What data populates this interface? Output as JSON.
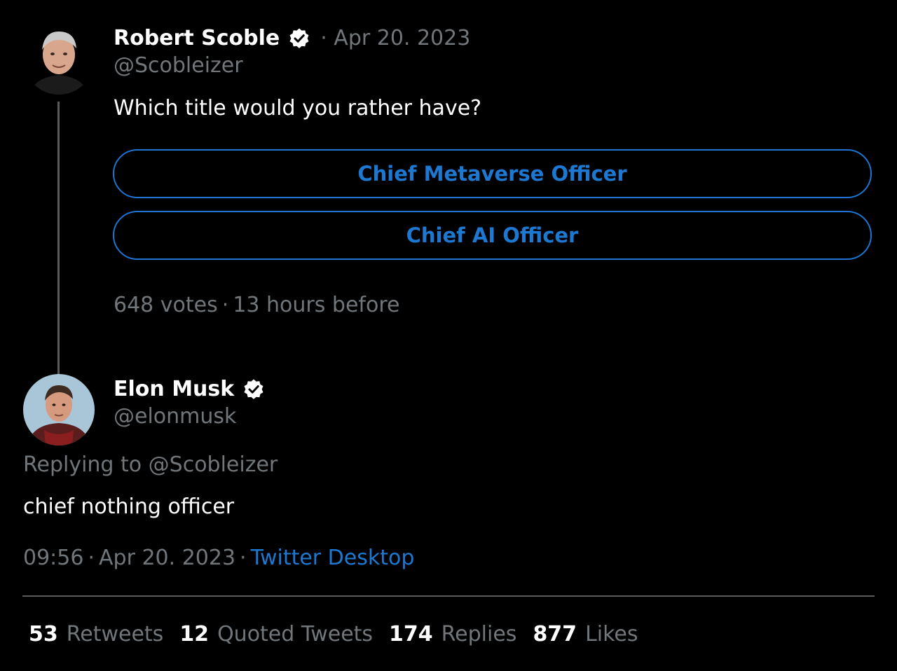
{
  "original_tweet": {
    "author_name": "Robert Scoble",
    "date": "· Apr 20. 2023",
    "handle": "@Scobleizer",
    "text": "Which title would you rather have?",
    "poll": {
      "options": [
        "Chief Metaverse Officer",
        "Chief AI Officer"
      ],
      "votes": "648 votes",
      "time_left": "13 hours before"
    }
  },
  "reply": {
    "author_name": "Elon Musk",
    "handle": "@elonmusk",
    "replying_to": "Replying to @Scobleizer",
    "text": "chief nothing officer",
    "time": "09:56",
    "date": "Apr 20. 2023",
    "source": "Twitter Desktop"
  },
  "stats": [
    {
      "count": "53",
      "label": "Retweets"
    },
    {
      "count": "12",
      "label": "Quoted Tweets"
    },
    {
      "count": "174",
      "label": "Replies"
    },
    {
      "count": "877",
      "label": "Likes"
    }
  ],
  "colors": {
    "background": "#000000",
    "muted": "#71767b",
    "accent": "#1d78d2",
    "verified_badge": "#ffffff"
  },
  "icons": {
    "verified": "verified-badge-icon"
  }
}
